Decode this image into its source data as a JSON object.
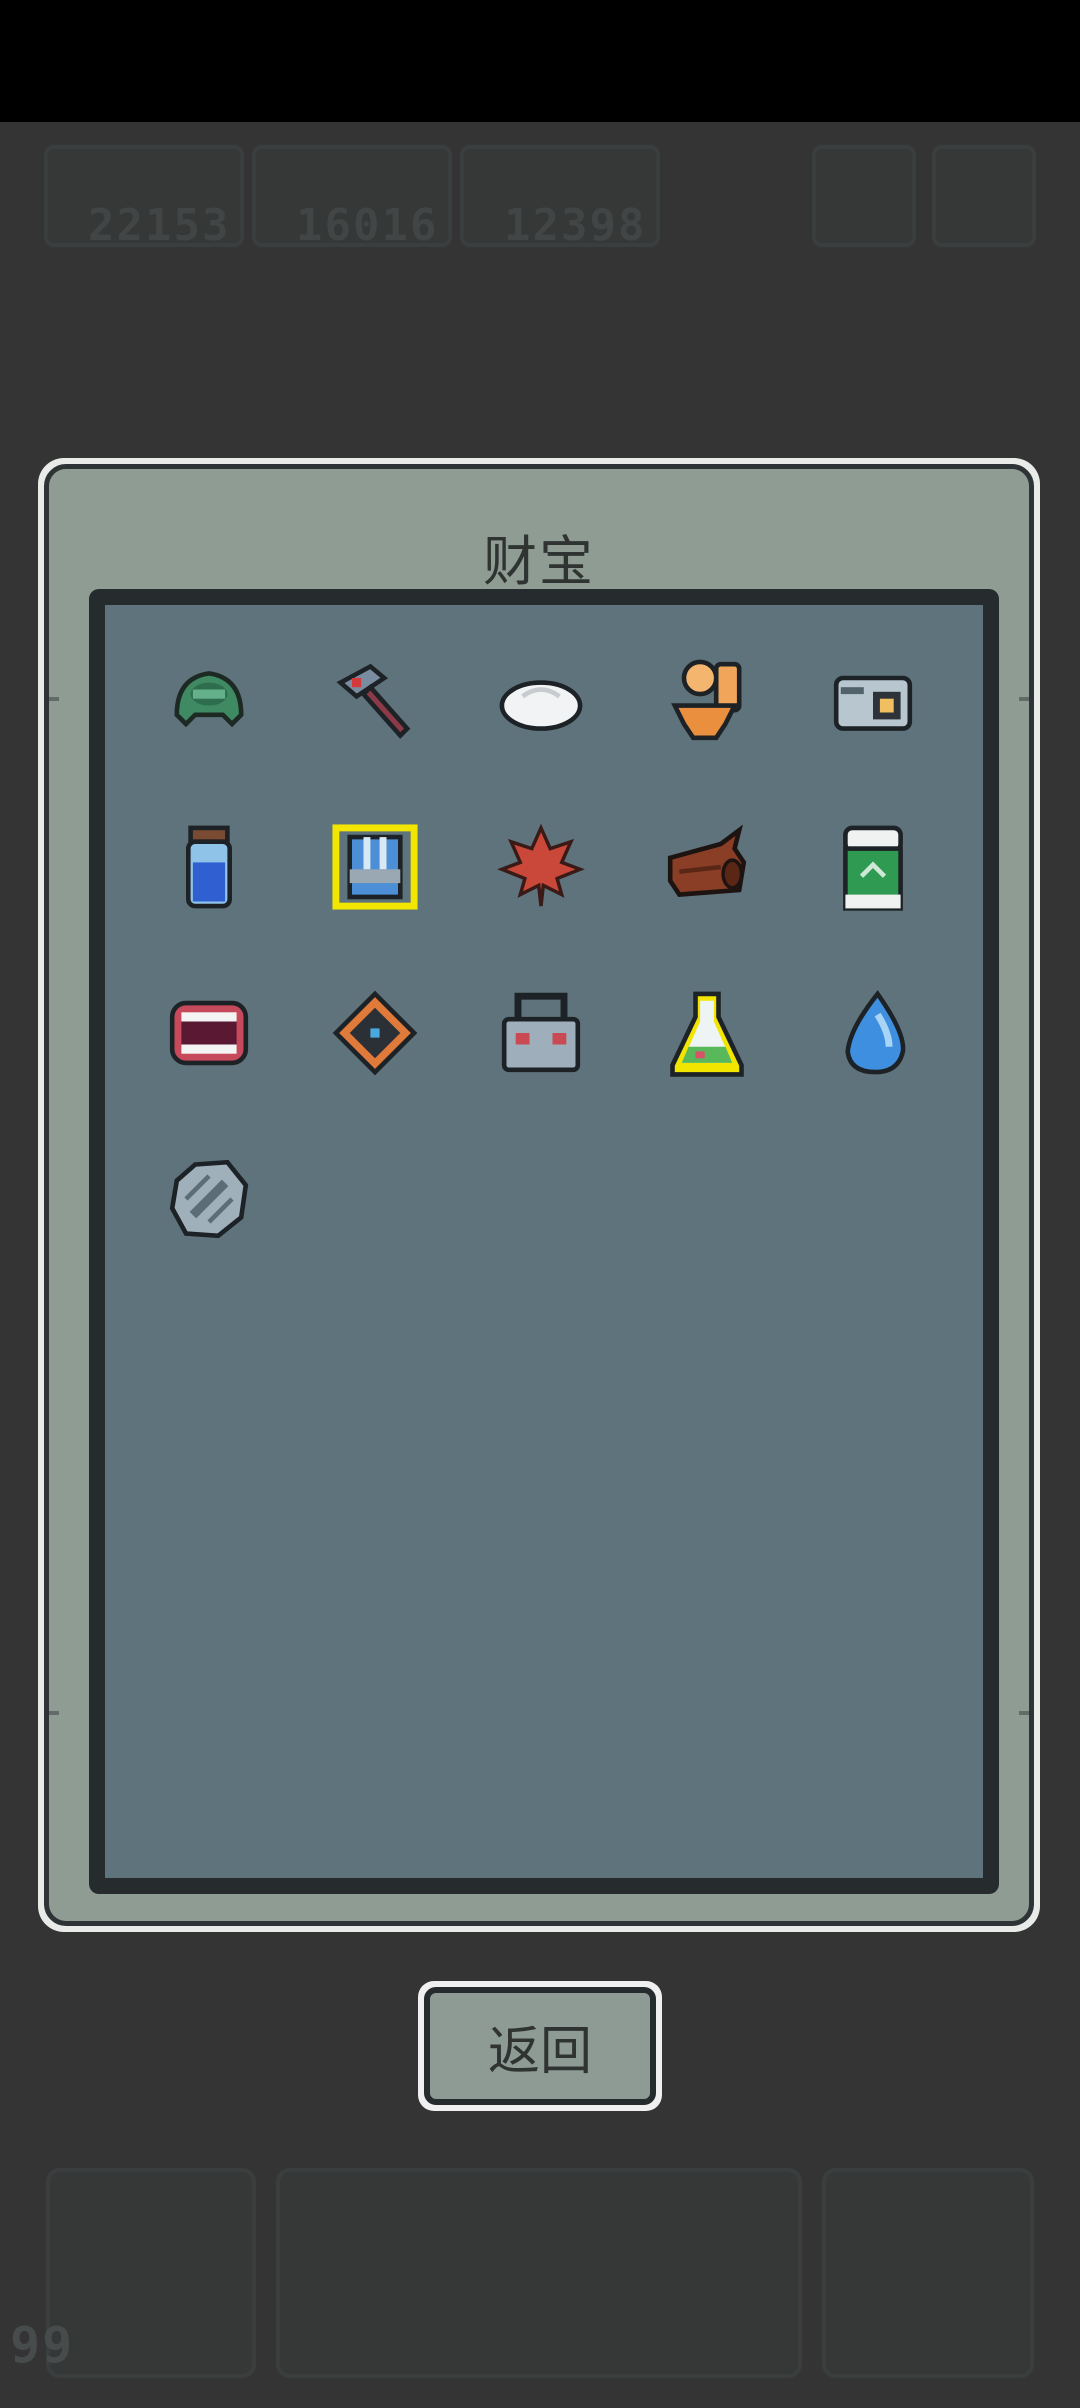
{
  "hud": {
    "resources": [
      {
        "icon": "gem-icon",
        "value": "22153"
      },
      {
        "icon": "leaf-icon",
        "value": "16016"
      },
      {
        "icon": "wood-icon",
        "value": "12398"
      }
    ],
    "bottom_counter": "99"
  },
  "dialog": {
    "title": "财宝",
    "items": [
      {
        "icon": "green-helmet-icon",
        "selected": false
      },
      {
        "icon": "hammer-icon",
        "selected": false
      },
      {
        "icon": "dumpling-icon",
        "selected": false
      },
      {
        "icon": "toilet-icon",
        "selected": false
      },
      {
        "icon": "camera-icon",
        "selected": false
      },
      {
        "icon": "blue-potion-jar-icon",
        "selected": false
      },
      {
        "icon": "blue-armor-icon",
        "selected": true
      },
      {
        "icon": "maple-leaf-icon",
        "selected": false
      },
      {
        "icon": "wooden-log-icon",
        "selected": false
      },
      {
        "icon": "recycle-bin-icon",
        "selected": false
      },
      {
        "icon": "chattering-teeth-icon",
        "selected": false
      },
      {
        "icon": "diamond-rune-icon",
        "selected": false
      },
      {
        "icon": "metal-box-icon",
        "selected": false
      },
      {
        "icon": "green-flask-icon",
        "selected": true
      },
      {
        "icon": "water-drop-icon",
        "selected": false
      },
      {
        "icon": "gear-cog-icon",
        "selected": false
      }
    ]
  },
  "back_button": {
    "label": "返回"
  },
  "colors": {
    "selected_outline": "#f2e600",
    "panel": "#5e737b",
    "dialog": "#8f9c94",
    "background": "#343434"
  }
}
